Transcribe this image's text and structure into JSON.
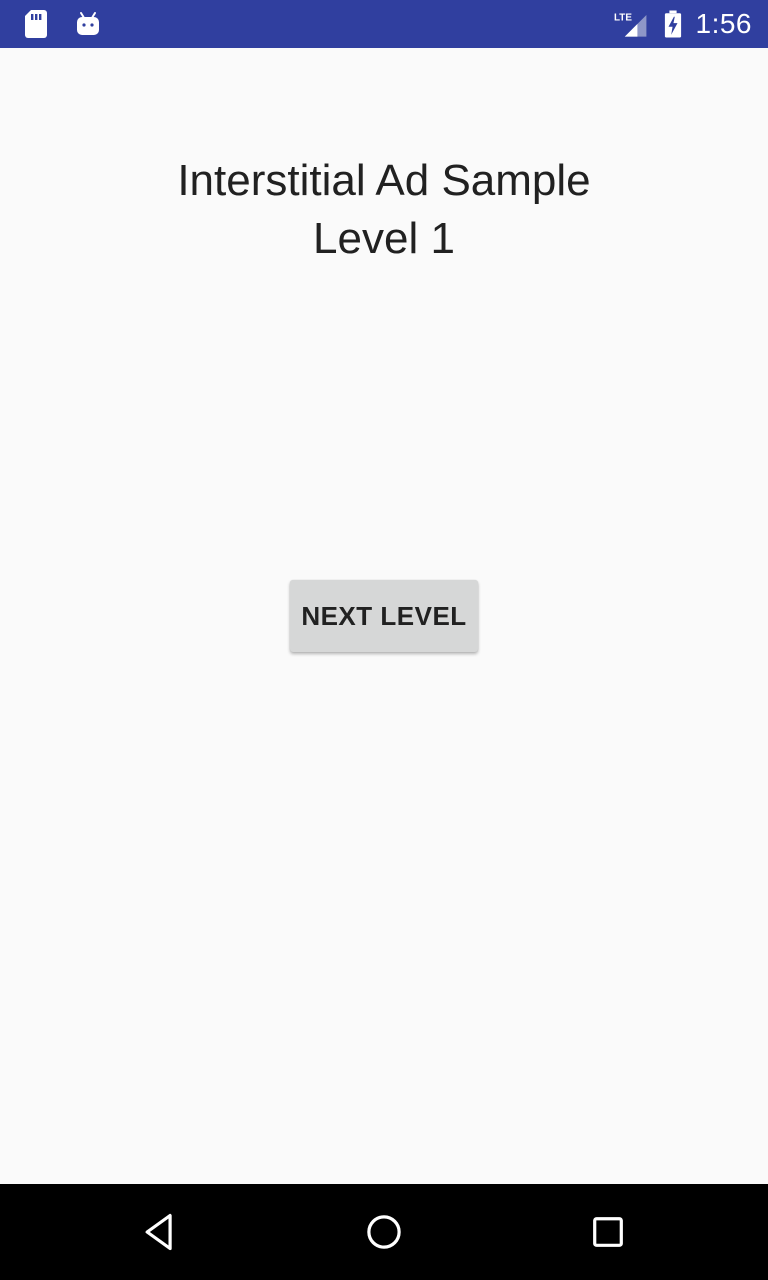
{
  "status_bar": {
    "time": "1:56",
    "network": "LTE",
    "icons": [
      "sd-card-icon",
      "android-debug-icon",
      "lte-signal-icon",
      "battery-charging-icon"
    ],
    "background_color": "#303f9f"
  },
  "main": {
    "title_line1": "Interstitial Ad Sample",
    "title_line2": "Level 1",
    "next_button_label": "NEXT LEVEL"
  },
  "nav_bar": {
    "icons": [
      "back-icon",
      "home-icon",
      "recents-icon"
    ]
  },
  "colors": {
    "background": "#fafafa",
    "button": "#d6d7d7",
    "text": "#212121",
    "nav_bar": "#000000"
  }
}
